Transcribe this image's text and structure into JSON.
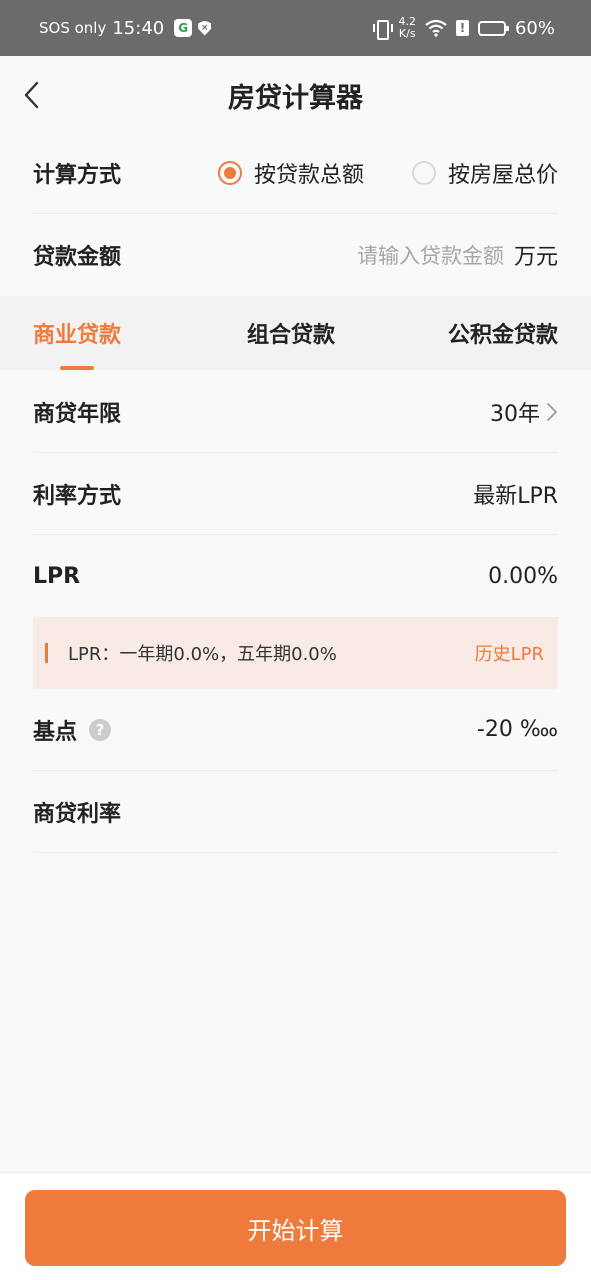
{
  "status_bar": {
    "carrier": "SOS only",
    "time": "15:40",
    "app_icon_letter": "G",
    "network_speed_value": "4.2",
    "network_speed_unit": "K/s",
    "battery": "60%",
    "battery_level": 0.6
  },
  "header": {
    "title": "房贷计算器"
  },
  "calc_method": {
    "label": "计算方式",
    "options": [
      {
        "label": "按贷款总额",
        "checked": true
      },
      {
        "label": "按房屋总价",
        "checked": false
      }
    ]
  },
  "loan_amount": {
    "label": "贷款金额",
    "placeholder": "请输入贷款金额",
    "unit": "万元"
  },
  "tabs": [
    {
      "label": "商业贷款",
      "active": true
    },
    {
      "label": "组合贷款",
      "active": false
    },
    {
      "label": "公积金贷款",
      "active": false
    }
  ],
  "loan_term": {
    "label": "商贷年限",
    "value": "30年"
  },
  "rate_method": {
    "label": "利率方式",
    "value": "最新LPR"
  },
  "lpr": {
    "label": "LPR",
    "value": "0.00%"
  },
  "lpr_info": {
    "text": "LPR：一年期0.0%，五年期0.0%",
    "link": "历史LPR"
  },
  "basis_point": {
    "label": "基点",
    "value": "-20 ‱"
  },
  "commercial_rate": {
    "label": "商贷利率",
    "value": ""
  },
  "action": {
    "calculate_label": "开始计算"
  },
  "colors": {
    "accent": "#ee7a3c",
    "info_bg": "#f8ebe5",
    "status_bar": "#6b6b6b"
  }
}
